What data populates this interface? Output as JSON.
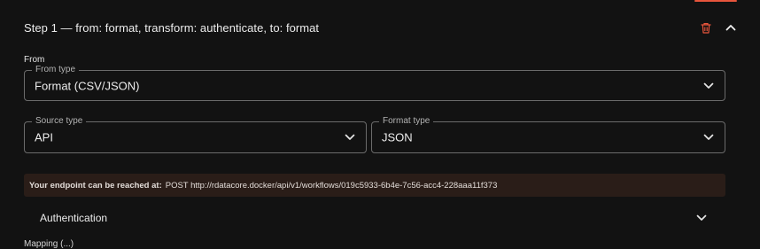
{
  "step": {
    "title": "Step 1 — from: format, transform: authenticate, to: format"
  },
  "from_section": {
    "label": "From",
    "from_type": {
      "legend": "From type",
      "value": "Format (CSV/JSON)"
    },
    "source_type": {
      "legend": "Source type",
      "value": "API"
    },
    "format_type": {
      "legend": "Format type",
      "value": "JSON"
    }
  },
  "endpoint": {
    "label": "Your endpoint can be reached at:",
    "value": "POST http://rdatacore.docker/api/v1/workflows/019c5933-6b4e-7c56-acc4-228aaa11f373"
  },
  "authentication": {
    "title": "Authentication"
  },
  "mapping": {
    "label": "Mapping (...)"
  },
  "icons": {
    "delete": "trash-icon",
    "collapse": "chevron-up-icon",
    "expand": "chevron-down-icon"
  },
  "colors": {
    "background": "#121212",
    "accent": "#e8553c",
    "banner_bg": "#2a1d18",
    "border": "#6b6b6b"
  }
}
